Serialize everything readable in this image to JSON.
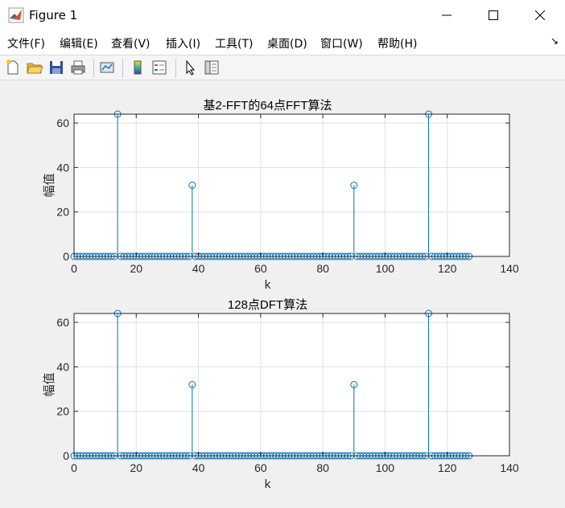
{
  "window": {
    "title": "Figure 1"
  },
  "menu": [
    "文件(F)",
    "编辑(E)",
    "查看(V)",
    "插入(I)",
    "工具(T)",
    "桌面(D)",
    "窗口(W)",
    "帮助(H)"
  ],
  "toolbar_icons": [
    "new-figure-icon",
    "open-file-icon",
    "save-icon",
    "print-icon",
    "link-plot-icon",
    "colorbar-icon",
    "legend-icon",
    "edit-plot-icon",
    "property-inspector-icon"
  ],
  "colors": {
    "stem": "#0072bd",
    "axes_bg": "#ffffff",
    "grid": "#e0e0e0"
  },
  "chart_data": [
    {
      "type": "stem",
      "title": "基2-FFT的64点FFT算法",
      "xlabel": "k",
      "ylabel": "幅值",
      "xlim": [
        0,
        140
      ],
      "ylim": [
        0,
        64
      ],
      "xticks": [
        0,
        20,
        40,
        60,
        80,
        100,
        120,
        140
      ],
      "yticks": [
        0,
        20,
        40,
        60
      ],
      "x_range": [
        0,
        127
      ],
      "baseline_value": 0,
      "peaks": [
        [
          14,
          64
        ],
        [
          38,
          32
        ],
        [
          90,
          32
        ],
        [
          114,
          64
        ]
      ],
      "grid": true
    },
    {
      "type": "stem",
      "title": "128点DFT算法",
      "xlabel": "k",
      "ylabel": "幅值",
      "xlim": [
        0,
        140
      ],
      "ylim": [
        0,
        64
      ],
      "xticks": [
        0,
        20,
        40,
        60,
        80,
        100,
        120,
        140
      ],
      "yticks": [
        0,
        20,
        40,
        60
      ],
      "x_range": [
        0,
        127
      ],
      "baseline_value": 0,
      "peaks": [
        [
          14,
          64
        ],
        [
          38,
          32
        ],
        [
          90,
          32
        ],
        [
          114,
          64
        ]
      ],
      "grid": true
    }
  ]
}
